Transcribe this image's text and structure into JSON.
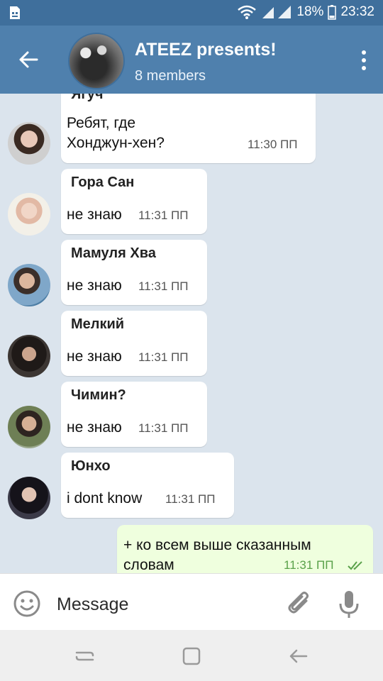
{
  "status_bar": {
    "battery": "18%",
    "time": "23:32",
    "icons": [
      "sim-manager-icon",
      "wifi-icon",
      "signal-icon",
      "battery-icon"
    ]
  },
  "header": {
    "title": "ATEEZ presents!",
    "subtitle": "8 members",
    "back_icon": "arrow-left-icon",
    "menu_icon": "more-vertical-icon"
  },
  "messages": [
    {
      "sender": "Ягуч",
      "text": "Ребят, где\nХонджун-хен?",
      "time": "11:30 ПП"
    },
    {
      "sender": "Гора Сан",
      "text": "не знаю",
      "time": "11:31 ПП"
    },
    {
      "sender": "Мамуля Хва",
      "text": "не знаю",
      "time": "11:31 ПП"
    },
    {
      "sender": "Мелкий",
      "text": "не знаю",
      "time": "11:31 ПП"
    },
    {
      "sender": "Чимин?",
      "text": "не знаю",
      "time": "11:31 ПП"
    },
    {
      "sender": "Юнхо",
      "text": "i dont know",
      "time": "11:31 ПП"
    }
  ],
  "outgoing": {
    "text": "+ ко всем выше сказанным\nсловам",
    "time": "11:31 ПП",
    "status_icon": "double-check-icon"
  },
  "input": {
    "placeholder": "Message"
  },
  "colors": {
    "header": "#4f80ad",
    "status_bar": "#3f6f9c",
    "outgoing_bubble": "#efffde",
    "incoming_bubble": "#ffffff"
  }
}
